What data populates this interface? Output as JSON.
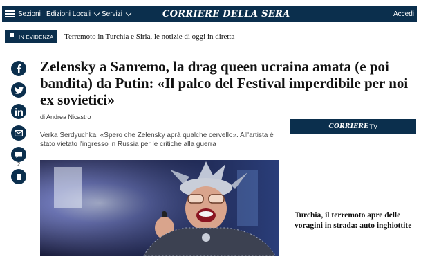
{
  "header": {
    "menu_label": "Sezioni",
    "editions_label": "Edizioni Locali",
    "services_label": "Servizi",
    "brand": "CORRIERE DELLA SERA",
    "login_label": "Accedi"
  },
  "breaking": {
    "badge": "IN EVIDENZA",
    "text": "Terremoto in Turchia e Siria, le notizie di oggi in diretta"
  },
  "share": {
    "comment_count": "2",
    "icons": [
      "facebook-icon",
      "twitter-icon",
      "linkedin-icon",
      "email-icon",
      "comment-icon",
      "bookmark-icon"
    ]
  },
  "article": {
    "headline": "Zelensky a Sanremo, la drag queen ucraina amata (e poi bandita) da Putin: «Il palco del Festival imperdibile per noi ex sovietici»",
    "byline": "di Andrea Nicastro",
    "summary": "Verka Serdyuchka: «Spero che Zelensky aprà qualche cervello». All'artista è stato vietato l'ingresso in Russia per le critiche alla guerra"
  },
  "sidebar": {
    "tv_brand": "CORRIERE",
    "tv_suffix": "TV",
    "video_title": "Turchia, il terremoto apre delle voragini in strada: auto inghiottite"
  },
  "colors": {
    "navy": "#0b2f4d",
    "text": "#111111"
  }
}
